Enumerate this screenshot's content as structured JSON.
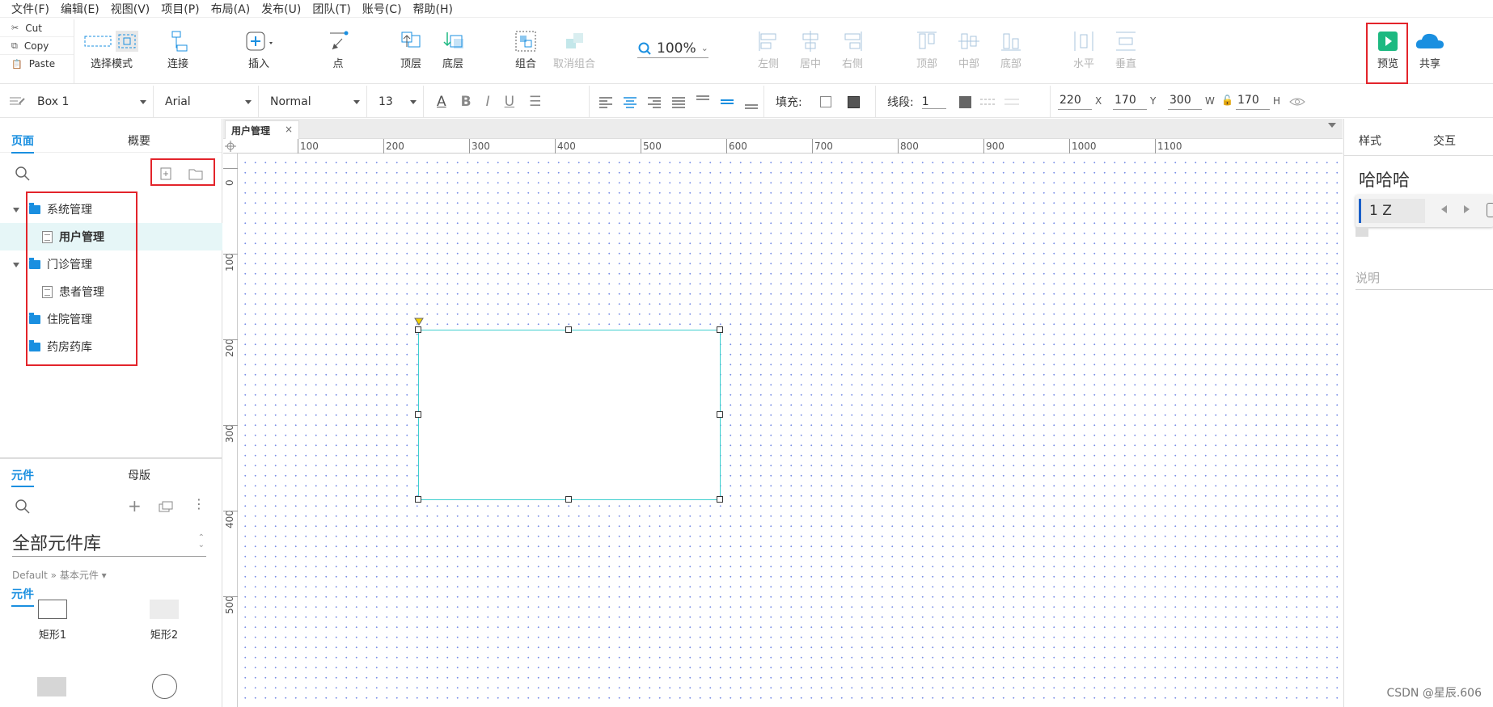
{
  "menu": [
    "文件(F)",
    "编辑(E)",
    "视图(V)",
    "项目(P)",
    "布局(A)",
    "发布(U)",
    "团队(T)",
    "账号(C)",
    "帮助(H)"
  ],
  "clipboard": {
    "cut": "Cut",
    "copy": "Copy",
    "paste": "Paste"
  },
  "toolbar": {
    "select_mode": "选择模式",
    "connect": "连接",
    "insert": "插入",
    "point": "点",
    "top_layer": "顶层",
    "bottom_layer": "底层",
    "group": "组合",
    "ungroup": "取消组合",
    "zoom": "100%",
    "align_left": "左侧",
    "align_center": "居中",
    "align_right": "右侧",
    "align_top": "顶部",
    "align_middle": "中部",
    "align_bottom": "底部",
    "distribute_h": "水平",
    "distribute_v": "垂直",
    "preview": "预览",
    "share": "共享"
  },
  "format": {
    "widget_name": "Box 1",
    "font": "Arial",
    "style": "Normal",
    "size": "13",
    "fill_label": "填充:",
    "stroke_label": "线段:",
    "stroke_width": "1",
    "x": "220",
    "y": "170",
    "w": "300",
    "h": "170",
    "x_label": "X",
    "y_label": "Y",
    "w_label": "W",
    "h_label": "H"
  },
  "left": {
    "tab_pages": "页面",
    "tab_outline": "概要",
    "tree": [
      {
        "label": "系统管理",
        "type": "folder",
        "expanded": true
      },
      {
        "label": "用户管理",
        "type": "page",
        "selected": true
      },
      {
        "label": "门诊管理",
        "type": "folder",
        "expanded": true
      },
      {
        "label": "患者管理",
        "type": "page"
      },
      {
        "label": "住院管理",
        "type": "folder"
      },
      {
        "label": "药房药库",
        "type": "folder"
      }
    ],
    "tab_widgets": "元件",
    "tab_masters": "母版",
    "library": "全部元件库",
    "library_path": "Default » 基本元件 ▾",
    "widgets": [
      "矩形1",
      "矩形2"
    ]
  },
  "canvas": {
    "tab": "用户管理",
    "hruler": [
      "100",
      "200",
      "300",
      "400",
      "500",
      "600",
      "700",
      "800",
      "900",
      "1000",
      "1100"
    ],
    "vruler": [
      "0",
      "100",
      "200",
      "300",
      "400",
      "500"
    ]
  },
  "right": {
    "tab_style": "样式",
    "tab_interact": "交互",
    "name": "哈哈哈",
    "ime": "1 Z",
    "notes_placeholder": "说明"
  },
  "watermark": "CSDN @星辰.606"
}
